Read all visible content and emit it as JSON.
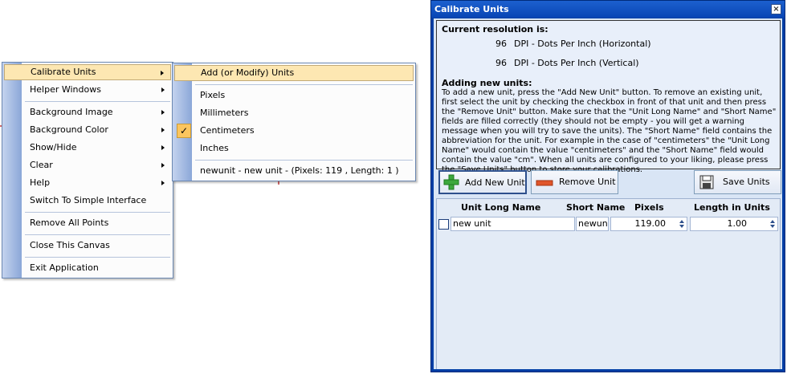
{
  "main_menu": {
    "items": [
      {
        "label": "Calibrate Units",
        "submenu": true,
        "highlighted": true
      },
      {
        "label": "Helper Windows",
        "submenu": true
      },
      {
        "label": "Background Image",
        "submenu": true
      },
      {
        "label": "Background Color",
        "submenu": true
      },
      {
        "label": "Show/Hide",
        "submenu": true
      },
      {
        "label": "Clear",
        "submenu": true
      },
      {
        "label": "Help",
        "submenu": true
      },
      {
        "label": "Switch To Simple Interface",
        "submenu": false
      },
      {
        "label": "Remove All Points",
        "submenu": false
      },
      {
        "label": "Close This Canvas",
        "submenu": false
      },
      {
        "label": "Exit Application",
        "submenu": false
      }
    ]
  },
  "sub_menu": {
    "items": [
      {
        "label": "Add (or Modify) Units",
        "highlighted": true
      },
      {
        "label": "Pixels"
      },
      {
        "label": "Millimeters"
      },
      {
        "label": "Centimeters",
        "checked": true
      },
      {
        "label": "Inches"
      },
      {
        "label": "newunit - new unit - (Pixels: 119 , Length: 1 )"
      }
    ]
  },
  "dialog": {
    "title": "Calibrate Units",
    "close_glyph": "×",
    "resolution_heading": "Current resolution is:",
    "dpi_h_value": "96",
    "dpi_h_label": "DPI  - Dots Per Inch (Horizontal)",
    "dpi_v_value": "96",
    "dpi_v_label": "DPI  - Dots Per Inch (Vertical)",
    "adding_heading": "Adding new units:",
    "adding_text": "To add a new unit, press the \"Add New Unit\" button. To remove an existing unit, first select the unit by checking the checkbox in front of that unit and then press the \"Remove Unit\" button. Make sure that the \"Unit Long Name\" and \"Short Name\" fields are filled correctly (they should not be empty - you will get a warning message when you will try to save the units). The \"Short Name\" field contains the abbreviation for the unit. For example in the case of \"centimeters\" the \"Unit Long Name\" would contain the value \"centimeters\" and the \"Short Name\" field would contain the value \"cm\". When all units are configured to your liking, please press the \"Save Units\" button to store your calibrations.",
    "buttons": {
      "add": "Add New Unit",
      "remove": "Remove Unit",
      "save": "Save Units"
    },
    "grid": {
      "columns": [
        "Unit Long Name",
        "Short Name",
        "Pixels",
        "Length in Units"
      ],
      "rows": [
        {
          "checked": false,
          "long_name": "new unit",
          "short_name": "newunit",
          "pixels": "119.00",
          "length": "1.00"
        }
      ]
    }
  },
  "colors": {
    "menu_highlight": "#fde7b2",
    "menu_gutter": "#8ba7d8",
    "title_bar": "#0845b4",
    "dialog_client": "#d9e5f5",
    "add_icon": "#3da83d",
    "remove_icon": "#e0552a"
  }
}
